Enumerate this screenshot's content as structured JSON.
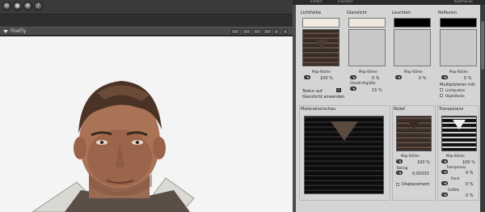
{
  "viewport": {
    "title": "FireFly"
  },
  "panel": {
    "tabs": [
      "Einfach",
      "Erweitert",
      "",
      "Kopfmenue"
    ],
    "channels": {
      "diffuse": {
        "label": "Lichtfarbe",
        "value_label": "Map-Stärke",
        "value": "100 %",
        "texture_label": "Textur auf",
        "apply_label": "Glanzlicht anwenden",
        "color": "#f1ebe3"
      },
      "specular": {
        "label": "Glanzlicht",
        "value_label": "Map-Stärke",
        "value": "0 %",
        "size_label": "Glanzlichtgröße",
        "size_value": "15 %",
        "color": "#ede7df"
      },
      "ambient": {
        "label": "Leuchten",
        "value_label": "Map-Stärke",
        "value": "0 %",
        "color": "#000000"
      },
      "reflection": {
        "label": "Reflexion",
        "value_label": "Map-Stärke",
        "value": "0 %",
        "multiply_label": "Multiplizieren mit:",
        "opt1": "Lichtquellen",
        "opt2": "Objektfarbe",
        "color": "#000000"
      }
    },
    "preview": {
      "label": "Materialvorschau"
    },
    "bump": {
      "label": "Relief",
      "strength_label": "Map-Stärke",
      "strength_value": "100 %",
      "amount_label": "Betrag",
      "amount_value": "0,00333",
      "displacement_label": "Displacement"
    },
    "transparency": {
      "label": "Transparenz",
      "strength_label": "Map-Stärke",
      "strength_value": "100 %",
      "edge_label": "Transparenz",
      "edge_value": "0 %",
      "falloff_label": "Rand",
      "falloff_value": "0 %",
      "gef_label": "Gefälle",
      "gef_value": "0 %"
    }
  }
}
